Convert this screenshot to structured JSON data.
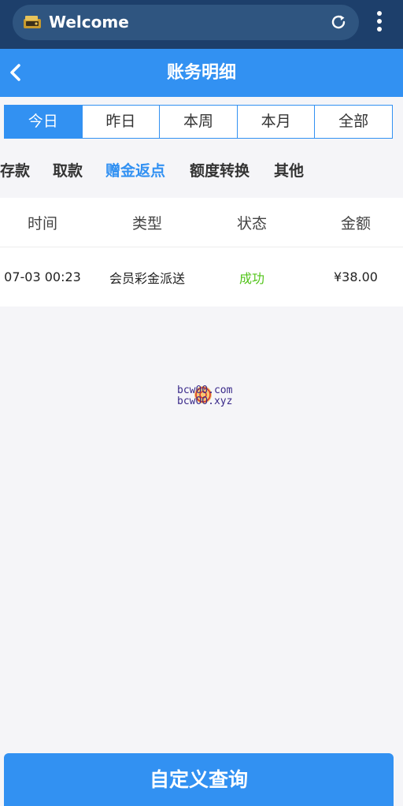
{
  "browser": {
    "title": "Welcome",
    "icons": {
      "site": "wallet-icon",
      "reload": "reload-icon",
      "menu": "more-vert-icon"
    }
  },
  "header": {
    "title": "账务明细",
    "back_icon": "chevron-left-icon"
  },
  "period_tabs": [
    {
      "label": "今日",
      "active": true
    },
    {
      "label": "昨日",
      "active": false
    },
    {
      "label": "本周",
      "active": false
    },
    {
      "label": "本月",
      "active": false
    },
    {
      "label": "全部",
      "active": false
    }
  ],
  "category_tabs": [
    {
      "label": "存款",
      "active": false
    },
    {
      "label": "取款",
      "active": false
    },
    {
      "label": "赠金返点",
      "active": true
    },
    {
      "label": "额度转换",
      "active": false
    },
    {
      "label": "其他",
      "active": false
    }
  ],
  "table": {
    "columns": [
      "时间",
      "类型",
      "状态",
      "金额"
    ],
    "rows": [
      {
        "time": "07-03 00:23",
        "type": "会员彩金派送",
        "status": "成功",
        "amount": "¥38.00"
      }
    ]
  },
  "watermark": {
    "line1": "bcw00.com",
    "line2": "bcwOO.xyz"
  },
  "footer": {
    "query_button": "自定义查询"
  },
  "colors": {
    "accent": "#3291f2",
    "browser_bar": "#1d3f6b",
    "success": "#52c41a",
    "background": "#f5f5f8"
  }
}
